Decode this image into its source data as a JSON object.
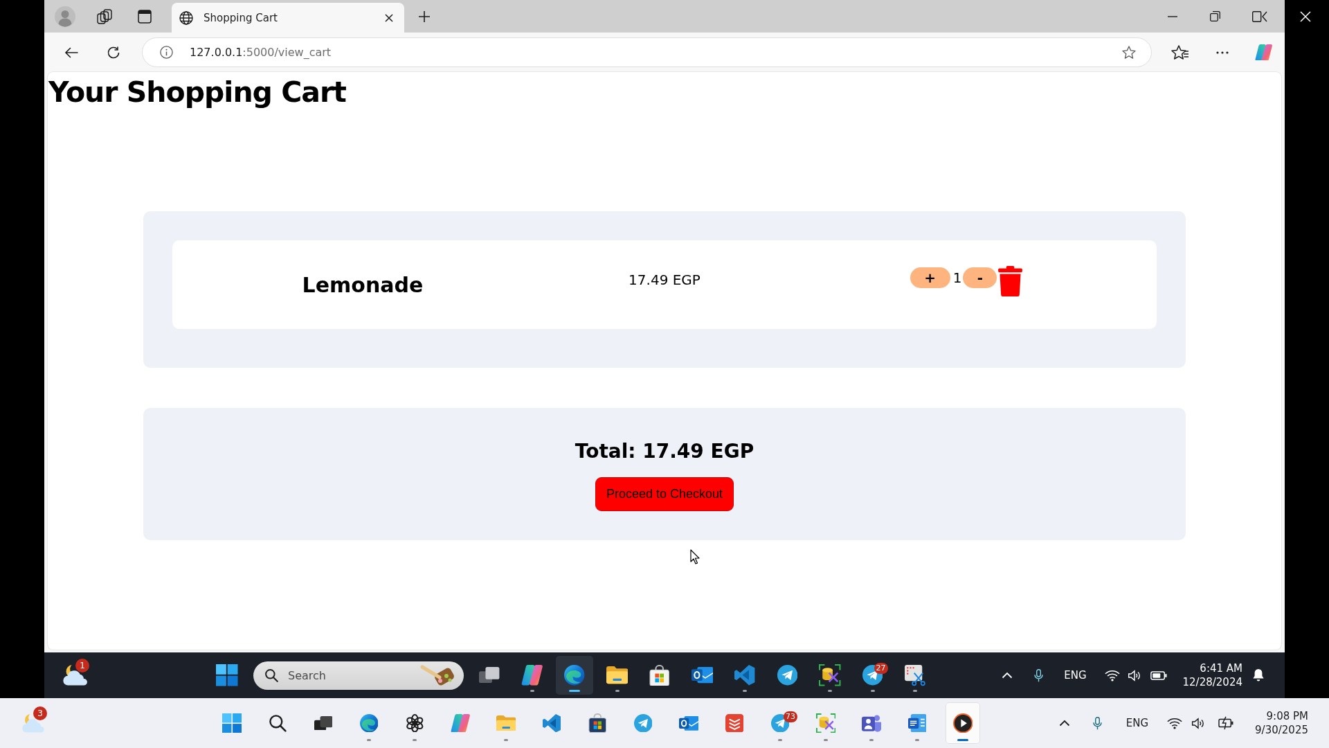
{
  "browser": {
    "tabs": [
      {
        "title": "Shopping Cart",
        "selected": true
      }
    ],
    "url": {
      "host": "127.0.0.1",
      "rest": ":5000/view_cart"
    }
  },
  "page": {
    "title": "Your Shopping Cart",
    "cart_items": [
      {
        "name": "Lemonade",
        "price": "17.49 EGP",
        "increase": "+",
        "quantity": "1",
        "decrease": "-"
      }
    ],
    "total": "Total: 17.49 EGP",
    "checkout_button": "Proceed to Checkout"
  },
  "inner_taskbar": {
    "weather": {
      "badge": "1"
    },
    "search": {
      "kind": "box",
      "placeholder": "Search"
    },
    "apps": [
      {
        "kind": "task-view",
        "running": false,
        "active": false
      },
      {
        "kind": "copilot",
        "running": true,
        "active": false
      },
      {
        "kind": "edge",
        "running": true,
        "active": true
      },
      {
        "kind": "explorer",
        "running": true,
        "active": false
      },
      {
        "kind": "store",
        "running": false,
        "active": false
      },
      {
        "kind": "outlook",
        "running": false,
        "active": false
      },
      {
        "kind": "vscode",
        "running": true,
        "active": false
      },
      {
        "kind": "telegram",
        "running": false,
        "active": false
      },
      {
        "kind": "db-tools",
        "running": true,
        "active": false
      },
      {
        "kind": "telegram",
        "running": true,
        "active": false,
        "badge": "27"
      },
      {
        "kind": "snipping",
        "running": true,
        "active": false
      }
    ],
    "tray": [
      {
        "kind": "caret"
      },
      {
        "kind": "mic"
      },
      {
        "kind": "language",
        "label": "ENG"
      },
      {
        "kind": "wifi"
      },
      {
        "kind": "volume"
      },
      {
        "kind": "battery"
      },
      {
        "kind": "clock",
        "time": "6:41 AM",
        "date": "12/28/2024"
      },
      {
        "kind": "notifications"
      }
    ]
  },
  "outer_taskbar": {
    "weather": {
      "badge": "3"
    },
    "search": {
      "kind": "button"
    },
    "apps": [
      {
        "kind": "task-view",
        "running": false,
        "active": false
      },
      {
        "kind": "edge",
        "running": true,
        "active": false
      },
      {
        "kind": "chatgpt",
        "running": true,
        "active": false
      },
      {
        "kind": "copilot",
        "running": false,
        "active": false
      },
      {
        "kind": "explorer",
        "running": true,
        "active": false
      },
      {
        "kind": "vscode",
        "running": false,
        "active": false
      },
      {
        "kind": "store",
        "running": false,
        "active": false
      },
      {
        "kind": "telegram",
        "running": false,
        "active": false
      },
      {
        "kind": "outlook",
        "running": false,
        "active": false
      },
      {
        "kind": "todo",
        "running": false,
        "active": false
      },
      {
        "kind": "telegram",
        "running": true,
        "active": false,
        "badge": "73"
      },
      {
        "kind": "db-tools",
        "running": true,
        "active": false
      },
      {
        "kind": "teams",
        "running": true,
        "active": false
      },
      {
        "kind": "word",
        "running": true,
        "active": false
      },
      {
        "kind": "media",
        "running": true,
        "active": true
      }
    ],
    "tray": [
      {
        "kind": "caret"
      },
      {
        "kind": "mic"
      },
      {
        "kind": "language",
        "label": "ENG"
      },
      {
        "kind": "wifi"
      },
      {
        "kind": "volume"
      },
      {
        "kind": "battery-charging"
      },
      {
        "kind": "clock",
        "time": "9:08 PM",
        "date": "9/30/2025"
      }
    ]
  }
}
